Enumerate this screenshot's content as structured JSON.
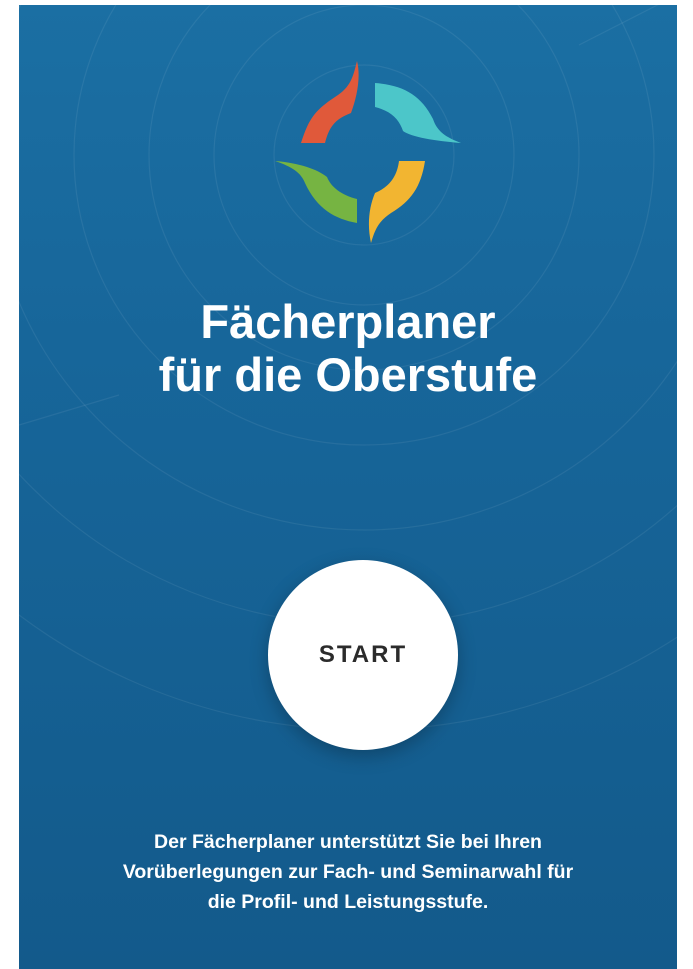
{
  "app": {
    "title_lines": [
      "Fächerplaner",
      "für die Oberstufe"
    ],
    "start_button_label": "START",
    "description_lines": [
      "Der Fächerplaner unterstützt Sie bei Ihren",
      "Vorüberlegungen zur Fach- und Seminarwahl für",
      "die Profil- und Leistungsstufe."
    ]
  },
  "icons": {
    "logo": "compass-logo-icon"
  },
  "colors": {
    "background": "#17669a",
    "logo_red": "#e0593a",
    "logo_teal": "#4cc6c9",
    "logo_green": "#76b442",
    "logo_yellow": "#f2b531",
    "button_bg": "#ffffff",
    "button_text": "#2b2b2b",
    "text": "#ffffff"
  }
}
